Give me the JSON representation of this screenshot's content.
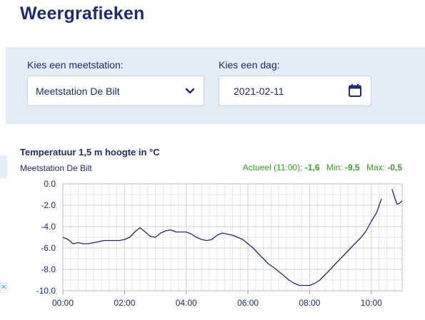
{
  "page": {
    "title": "Weergrafieken"
  },
  "filters": {
    "station_label": "Kies een meetstation:",
    "station_value": "Meetstation De Bilt",
    "day_label": "Kies een dag:",
    "day_value": "2021-02-11"
  },
  "chart": {
    "title": "Temperatuur 1,5 m hoogte in °C",
    "station": "Meetstation De Bilt",
    "current_label": "Actueel (11:00):",
    "current_value": "-1,6",
    "min_label": "Min:",
    "min_value": "-9,5",
    "max_label": "Max:",
    "max_value": "-0,5"
  },
  "colors": {
    "accent": "#1e2b6f",
    "panel": "#e2edf8",
    "stats": "#3c9a2e",
    "line": "#1e2b6f"
  },
  "icons": {
    "select": "chevron-down-icon",
    "date": "calendar-icon",
    "ad": "close-icon"
  },
  "ad_badge": "✕",
  "chart_data": {
    "type": "line",
    "title": "Temperatuur 1,5 m hoogte in °C",
    "xlabel": "",
    "ylabel": "",
    "x_ticks": [
      "00:00",
      "02:00",
      "04:00",
      "06:00",
      "08:00",
      "10:00"
    ],
    "y_ticks": [
      "0.0",
      "-2.0",
      "-4.0",
      "-6.0",
      "-8.0",
      "-10.0"
    ],
    "xlim": [
      0,
      11
    ],
    "ylim": [
      -10,
      0
    ],
    "grid": true,
    "series": [
      {
        "segments": [
          {
            "x": [
              0.0,
              0.17,
              0.33,
              0.5,
              0.67,
              0.83,
              1.0,
              1.17,
              1.33,
              1.5,
              1.67,
              1.83,
              2.0,
              2.17,
              2.33,
              2.5,
              2.67,
              2.83,
              3.0,
              3.17,
              3.33,
              3.5,
              3.67,
              3.83,
              4.0,
              4.17,
              4.33,
              4.5,
              4.67,
              4.83,
              5.0,
              5.17,
              5.33,
              5.5,
              5.67,
              5.83,
              6.0,
              6.17,
              6.33,
              6.5,
              6.67,
              6.83,
              7.0,
              7.17,
              7.33,
              7.5,
              7.67,
              7.83,
              8.0,
              8.17,
              8.33,
              8.5,
              8.67,
              8.83,
              9.0,
              9.17,
              9.33,
              9.5,
              9.67,
              9.83,
              10.0,
              10.17,
              10.33
            ],
            "y": [
              -5.0,
              -5.2,
              -5.6,
              -5.5,
              -5.6,
              -5.6,
              -5.5,
              -5.4,
              -5.3,
              -5.3,
              -5.3,
              -5.3,
              -5.2,
              -5.0,
              -4.5,
              -4.1,
              -4.5,
              -4.9,
              -5.0,
              -4.6,
              -4.4,
              -4.3,
              -4.5,
              -4.5,
              -4.5,
              -4.7,
              -5.0,
              -5.2,
              -5.3,
              -5.2,
              -4.8,
              -4.6,
              -4.7,
              -4.8,
              -5.0,
              -5.2,
              -5.6,
              -6.0,
              -6.5,
              -7.0,
              -7.5,
              -7.8,
              -8.2,
              -8.6,
              -9.0,
              -9.3,
              -9.5,
              -9.5,
              -9.5,
              -9.3,
              -9.0,
              -8.5,
              -8.0,
              -7.5,
              -7.0,
              -6.5,
              -6.0,
              -5.5,
              -5.0,
              -4.4,
              -3.5,
              -2.7,
              -1.4
            ]
          },
          {
            "x": [
              10.67,
              10.75,
              10.83,
              10.92,
              11.0
            ],
            "y": [
              -0.5,
              -1.2,
              -1.9,
              -1.8,
              -1.6
            ]
          }
        ]
      }
    ]
  }
}
